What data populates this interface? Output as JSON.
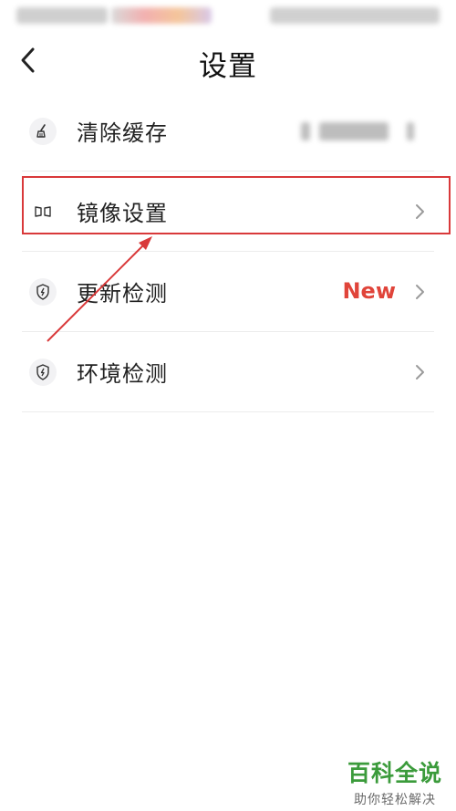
{
  "header": {
    "title": "设置"
  },
  "settings": {
    "items": [
      {
        "label": "清除缓存"
      },
      {
        "label": "镜像设置"
      },
      {
        "label": "更新检测",
        "badge": "New"
      },
      {
        "label": "环境检测"
      }
    ]
  },
  "brand": {
    "title": "百科全说",
    "subtitle": "助你轻松解决"
  },
  "colors": {
    "accent_red": "#e0443a",
    "brand_green": "#3b9b3b"
  }
}
